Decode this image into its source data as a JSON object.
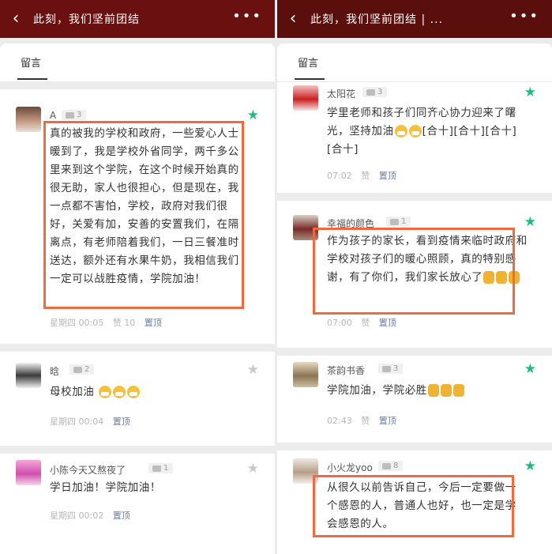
{
  "left": {
    "header": {
      "back_icon": "chevron-left-icon",
      "title": "此刻，我们坚前团结",
      "more_icon": "more-dots-icon"
    },
    "tab_label": "留言",
    "comments": [
      {
        "name": "A",
        "badge": "3",
        "text": "真的被我的学校和政府，一些爱心人士暖到了，我是学校外省同学，两千多公里来到这个学院，在这个时候开始真的很无助，家人也很担心，但是现在，我一点都不害怕，学校，政府对我们很好，关爱有加，安善的安置我们，在隔离点，有老师陪着我们，一日三餐准时送达，额外还有水果牛奶，我相信我们一定可以战胜疫情，学院加油！",
        "time": "星期四",
        "clock": "00:05",
        "likes": "赞 10",
        "reply": "置顶",
        "starred": true
      },
      {
        "name": "晗",
        "badge": "2",
        "text": "母校加油",
        "time": "星期四",
        "clock": "00:04",
        "likes": "",
        "reply": "置顶",
        "starred": false
      },
      {
        "name": "小陈今天又熬夜了",
        "badge": "1",
        "text": "学日加油！学院加油！",
        "time": "星期四",
        "clock": "00:02",
        "likes": "",
        "reply": "置顶",
        "starred": false
      }
    ]
  },
  "right": {
    "header": {
      "back_icon": "chevron-left-icon",
      "title": "此刻，我们坚前团结 | ...",
      "more_icon": "more-dots-icon"
    },
    "tab_label": "留言",
    "comments": [
      {
        "name": "太阳花",
        "badge": "3",
        "text": "学里老师和孩子们同齐心协力迎来了曙光，坚持加油",
        "tail": "[合十][合十][合十][合十]",
        "time": "07:02",
        "likes": "赞",
        "reply": "置顶",
        "starred": true
      },
      {
        "name": "幸福的颜色",
        "badge": "1",
        "text": "作为孩子的家长，看到疫情来临时政府和学校对孩子们的暖心照顾，真的特别感谢，有了你们，我们家长放心了",
        "time": "07:00",
        "likes": "赞",
        "reply": "置顶",
        "starred": true
      },
      {
        "name": "茶韵书香",
        "badge": "3",
        "text": "学院加油，学院必胜",
        "time": "02:43",
        "likes": "赞",
        "reply": "置顶",
        "starred": true
      },
      {
        "name": "小火龙yoo",
        "badge": "8",
        "text": "从很久以前告诉自己，今后一定要做一个感恩的人，普通人也好，也一定是学会感恩的人。",
        "time": "",
        "likes": "",
        "reply": "",
        "starred": true
      }
    ]
  }
}
